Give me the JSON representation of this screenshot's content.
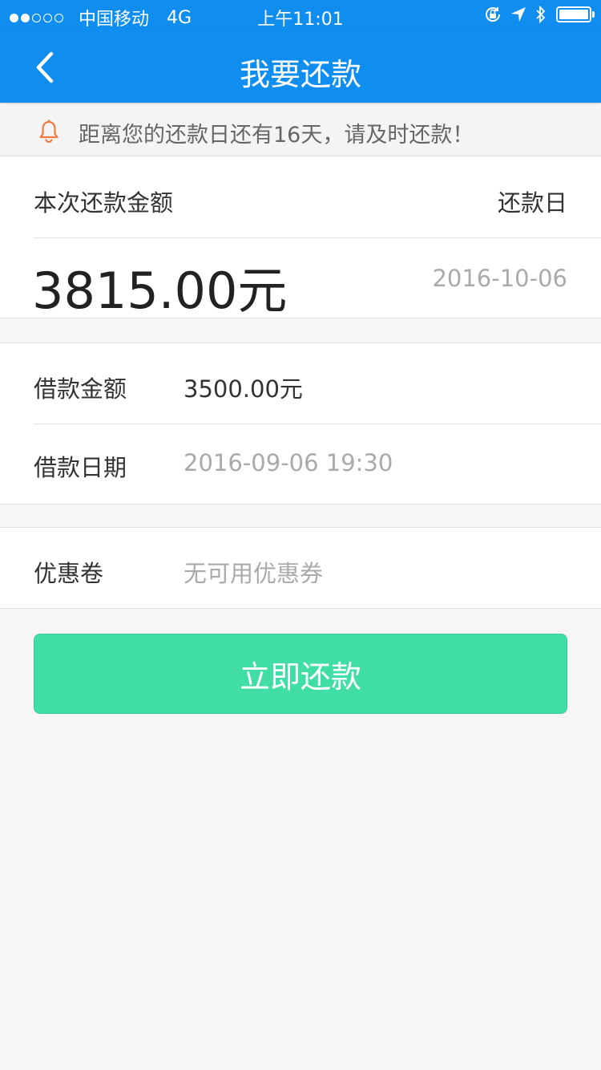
{
  "status_bar": {
    "carrier": "中国移动",
    "network": "4G",
    "time": "上午11:01",
    "signal_bars": 2,
    "signal_total": 5,
    "icons": [
      "orientation-lock-icon",
      "location-icon",
      "bluetooth-icon",
      "battery-icon"
    ],
    "battery_level": 1.0
  },
  "nav": {
    "title": "我要还款",
    "back_icon": "chevron-left-icon"
  },
  "notice": {
    "icon": "bell-icon",
    "text": "距离您的还款日还有16天，请及时还款！",
    "icon_color": "#f07b3f"
  },
  "repayment": {
    "amount_label": "本次还款金额",
    "due_label": "还款日",
    "amount": "3815.00元",
    "due_date": "2016-10-06"
  },
  "loan": {
    "amount_label": "借款金额",
    "amount_value": "3500.00元",
    "date_label": "借款日期",
    "date_value": "2016-09-06 19:30"
  },
  "coupon": {
    "label": "优惠卷",
    "value": "无可用优惠券"
  },
  "action": {
    "pay_label": "立即还款"
  },
  "colors": {
    "primary": "#0f8ef0",
    "button": "#40dea4",
    "muted": "#aaaaaa"
  }
}
